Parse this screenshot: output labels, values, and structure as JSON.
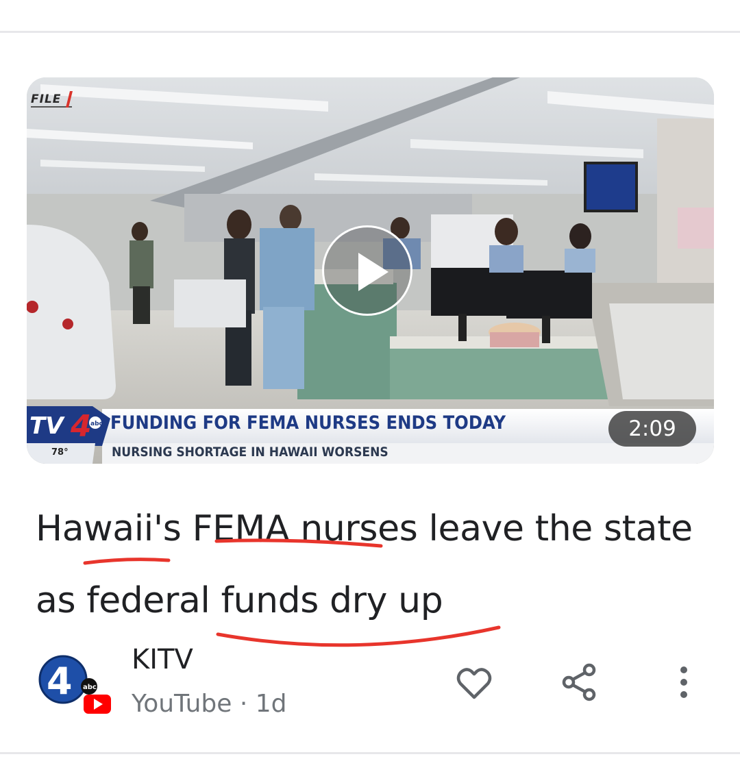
{
  "video": {
    "file_tag": "FILE",
    "headline": "FUNDING FOR FEMA NURSES ENDS TODAY",
    "subline": "NURSING SHORTAGE IN HAWAII WORSENS",
    "station_logo": "TV4",
    "temperature": "78°",
    "duration": "2:09",
    "play_icon": "play-icon"
  },
  "article": {
    "title_parts": [
      "Hawaii's ",
      "FEMA",
      " nurses leave the state as federal funds dry up"
    ],
    "annotation_color": "#e8352c"
  },
  "source": {
    "channel": "KITV",
    "platform": "YouTube",
    "separator": " · ",
    "age": "1d",
    "logo_number": "4",
    "logo_network": "abc"
  },
  "actions": {
    "icons": [
      "heart-icon",
      "share-icon",
      "more-vert-icon"
    ]
  },
  "colors": {
    "headline_blue": "#1e3a85",
    "text": "#202124",
    "secondary_text": "#70757a",
    "youtube_red": "#ff0000"
  }
}
